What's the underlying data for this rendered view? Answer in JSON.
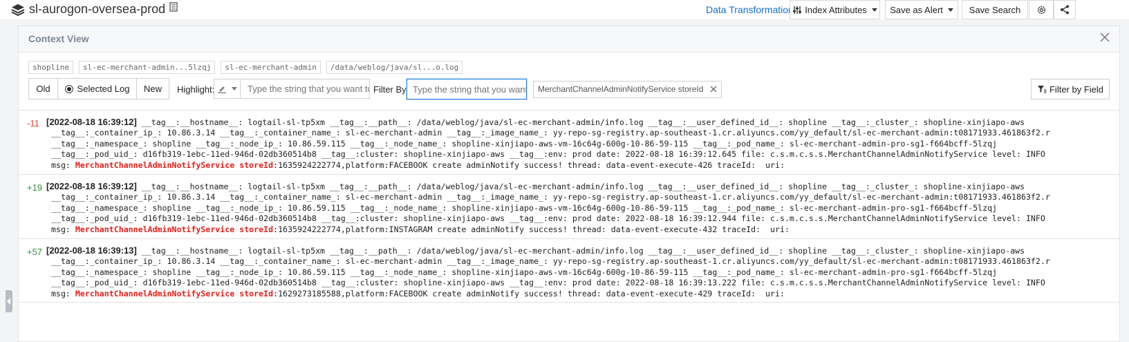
{
  "topbar": {
    "project_name": "sl-aurogon-oversea-prod",
    "data_transformation": "Data Transformation",
    "index_attributes": "Index Attributes",
    "save_as_alert": "Save as Alert",
    "save_search": "Save Search"
  },
  "panel": {
    "title": "Context View",
    "chips": [
      "shopline",
      "sl-ec-merchant-admin...5lzqj",
      "sl-ec-merchant-admin",
      "/data/weblog/java/sl...o.log"
    ],
    "segment": {
      "old": "Old",
      "selected": "Selected Log",
      "new": "New"
    },
    "highlight_label": "Highlight:",
    "highlight_placeholder": "Type the string that you want to highlight",
    "filter_by_label": "Filter By:",
    "filter_placeholder": "Type the string that you want to filter",
    "filter_tag": "MerchantChannelAdminNotifyService storeId",
    "filter_by_field": "Filter by Field"
  },
  "logs": [
    {
      "offset": "-11",
      "timestamp": "[2022-08-18 16:39:12]",
      "line1": " __tag__:__hostname__: logtail-sl-tp5xm __tag__:__path__: /data/weblog/java/sl-ec-merchant-admin/info.log __tag__:__user_defined_id__: shopline __tag__:_cluster_: shopline-xinjiapo-aws",
      "line2": " __tag__:_container_ip_: 10.86.3.14 __tag__:_container_name_: sl-ec-merchant-admin __tag__:_image_name_: yy-repo-sg-registry.ap-southeast-1.cr.aliyuncs.com/yy_default/sl-ec-merchant-admin:t08171933.461863f2.r",
      "line3": " __tag__:_namespace_: shopline __tag__:_node_ip_: 10.86.59.115 __tag__:_node_name_: shopline-xinjiapo-aws-vm-16c64g-600g-10-86-59-115 __tag__:_pod_name_: sl-ec-merchant-admin-pro-sg1-f664bcff-5lzqj",
      "line4": " __tag__:_pod_uid_: d16fb319-1ebc-11ed-946d-02db360514b8 __tag__:cluster: shopline-xinjiapo-aws __tag__:env: prod date: 2022-08-18 16:39:12.645 file: c.s.m.c.s.s.MerchantChannelAdminNotifyService level: INFO",
      "msg_prefix": " msg: ",
      "hl1": "MerchantChannelAdminNotifyService",
      "hl2": "storeId",
      "msg_rest": ":1635924222774,platform:FACEBOOK create adminNotify success! thread: data-event-execute-426 traceId:  uri:"
    },
    {
      "offset": "+19",
      "timestamp": "[2022-08-18 16:39:12]",
      "line1": " __tag__:__hostname__: logtail-sl-tp5xm __tag__:__path__: /data/weblog/java/sl-ec-merchant-admin/info.log __tag__:__user_defined_id__: shopline __tag__:_cluster_: shopline-xinjiapo-aws",
      "line2": " __tag__:_container_ip_: 10.86.3.14 __tag__:_container_name_: sl-ec-merchant-admin __tag__:_image_name_: yy-repo-sg-registry.ap-southeast-1.cr.aliyuncs.com/yy_default/sl-ec-merchant-admin:t08171933.461863f2.r",
      "line3": " __tag__:_namespace_: shopline __tag__:_node_ip_: 10.86.59.115 __tag__:_node_name_: shopline-xinjiapo-aws-vm-16c64g-600g-10-86-59-115 __tag__:_pod_name_: sl-ec-merchant-admin-pro-sg1-f664bcff-5lzqj",
      "line4": " __tag__:_pod_uid_: d16fb319-1ebc-11ed-946d-02db360514b8 __tag__:cluster: shopline-xinjiapo-aws __tag__:env: prod date: 2022-08-18 16:39:12.944 file: c.s.m.c.s.s.MerchantChannelAdminNotifyService level: INFO",
      "msg_prefix": " msg: ",
      "hl1": "MerchantChannelAdminNotifyService",
      "hl2": "storeId",
      "msg_rest": ":1635924222774,platform:INSTAGRAM create adminNotify success! thread: data-event-execute-432 traceId:  uri:"
    },
    {
      "offset": "+57",
      "timestamp": "[2022-08-18 16:39:13]",
      "line1": " __tag__:__hostname__: logtail-sl-tp5xm __tag__:__path__: /data/weblog/java/sl-ec-merchant-admin/info.log __tag__:__user_defined_id__: shopline __tag__:_cluster_: shopline-xinjiapo-aws",
      "line2": " __tag__:_container_ip_: 10.86.3.14 __tag__:_container_name_: sl-ec-merchant-admin __tag__:_image_name_: yy-repo-sg-registry.ap-southeast-1.cr.aliyuncs.com/yy_default/sl-ec-merchant-admin:t08171933.461863f2.r",
      "line3": " __tag__:_namespace_: shopline __tag__:_node_ip_: 10.86.59.115 __tag__:_node_name_: shopline-xinjiapo-aws-vm-16c64g-600g-10-86-59-115 __tag__:_pod_name_: sl-ec-merchant-admin-pro-sg1-f664bcff-5lzqj",
      "line4": " __tag__:_pod_uid_: d16fb319-1ebc-11ed-946d-02db360514b8 __tag__:cluster: shopline-xinjiapo-aws __tag__:env: prod date: 2022-08-18 16:39:13.222 file: c.s.m.c.s.s.MerchantChannelAdminNotifyService level: INFO",
      "msg_prefix": " msg: ",
      "hl1": "MerchantChannelAdminNotifyService",
      "hl2": "storeId",
      "msg_rest": ":1629273185588,platform:FACEBOOK create adminNotify success! thread: data-event-execute-429 traceId:  uri:"
    }
  ],
  "colors": {
    "accent": "#1470cc",
    "highlight": "#e0201b",
    "offset_negative": "#e0483a",
    "offset_positive": "#3a8f3a"
  }
}
